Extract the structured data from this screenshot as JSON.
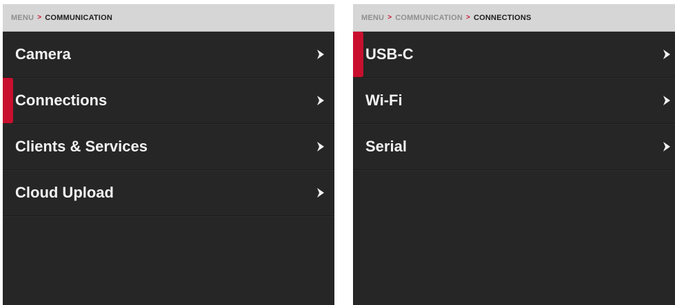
{
  "left_screen": {
    "breadcrumb": {
      "root": "MENU",
      "separator": ">",
      "current": "COMMUNICATION"
    },
    "items": [
      {
        "label": "Camera",
        "icon": "chevron-right-icon",
        "selected": false
      },
      {
        "label": "Connections",
        "icon": "chevron-right-icon",
        "selected": true
      },
      {
        "label": "Clients & Services",
        "icon": "chevron-right-icon",
        "selected": false
      },
      {
        "label": "Cloud Upload",
        "icon": "chevron-right-icon",
        "selected": false
      }
    ]
  },
  "right_screen": {
    "breadcrumb": {
      "root": "MENU",
      "separator": ">",
      "middle": "COMMUNICATION",
      "current": "CONNECTIONS"
    },
    "items": [
      {
        "label": "USB-C",
        "icon": "chevron-right-icon",
        "selected": true
      },
      {
        "label": "Wi-Fi",
        "icon": "chevron-right-icon",
        "selected": false
      },
      {
        "label": "Serial",
        "icon": "chevron-right-icon",
        "selected": false
      }
    ]
  },
  "colors": {
    "background": "#262626",
    "breadcrumb_bg": "#d6d6d6",
    "accent": "#c8102e",
    "text": "#f2f2f2"
  }
}
